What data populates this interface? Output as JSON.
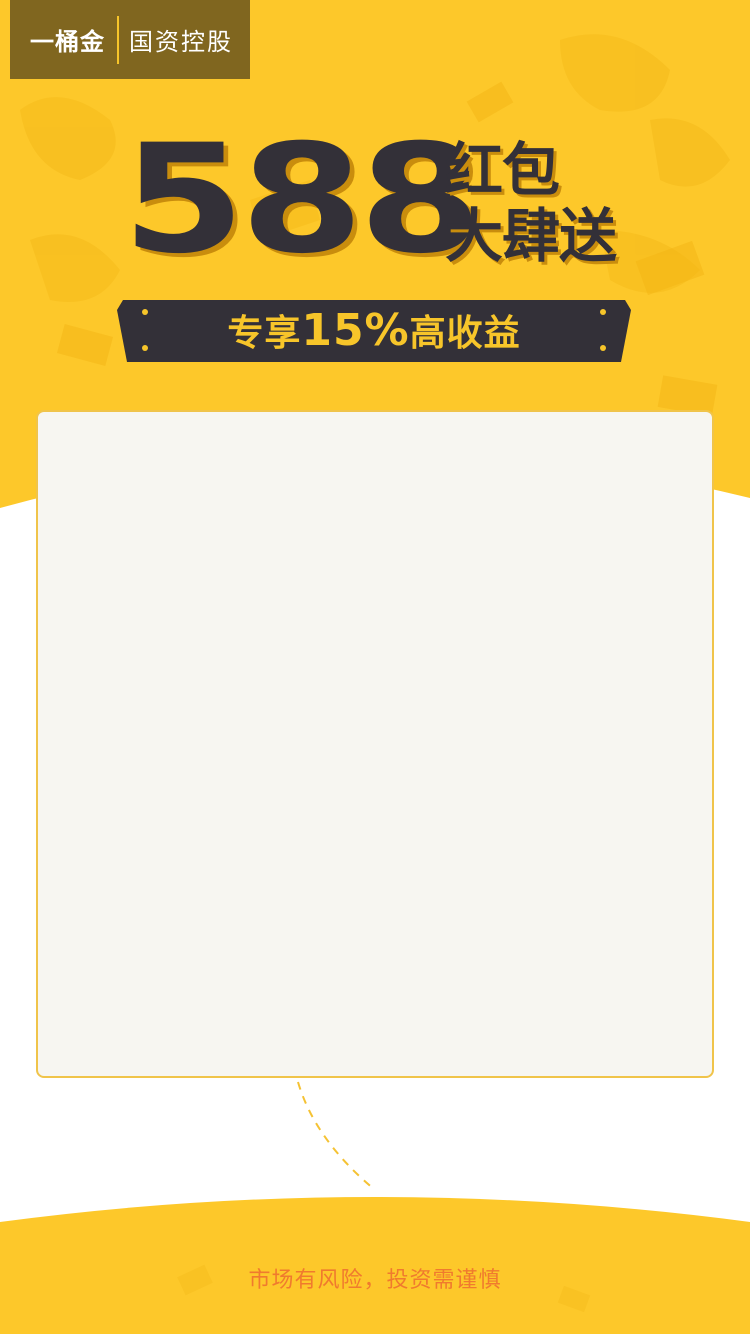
{
  "brand": {
    "name": "一桶金",
    "slogan": "国资控股"
  },
  "headline": {
    "amount": "588",
    "line1": "红包",
    "line2": "大肆送"
  },
  "ribbon": {
    "prefix": "专享",
    "rate": "15%",
    "suffix": "高收益"
  },
  "footer": {
    "risk_notice": "市场有风险，投资需谨慎"
  },
  "colors": {
    "primary_yellow": "#fdc82a",
    "dark": "#333038",
    "shadow_gold": "#c98d0d",
    "card_bg": "#f7f6f1",
    "card_border": "#f0c44a",
    "notice_orange": "#f07a2e"
  }
}
